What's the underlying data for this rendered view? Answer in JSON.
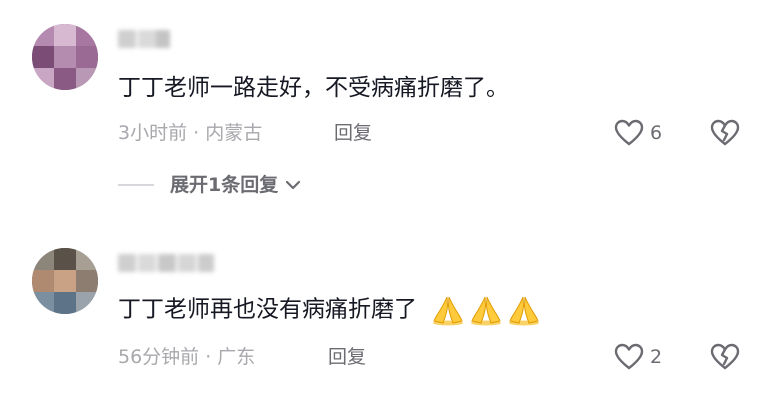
{
  "comments": [
    {
      "text": "丁丁老师一路走好，不受病痛折磨了。",
      "meta": "3小时前 · 内蒙古",
      "reply_label": "回复",
      "like_count": "6"
    },
    {
      "text": "丁丁老师再也没有病痛折磨了",
      "meta": "56分钟前 · 广东",
      "reply_label": "回复",
      "like_count": "2"
    }
  ],
  "expand_replies_label": "展开1条回复",
  "icons": {
    "like": "heart-outline-icon",
    "dislike": "broken-heart-icon",
    "expand": "chevron-down-icon",
    "emoji": "folded-hands-emoji"
  },
  "colors": {
    "text": "#161823",
    "meta": "#a8a8ad",
    "action": "#6b6b72"
  }
}
